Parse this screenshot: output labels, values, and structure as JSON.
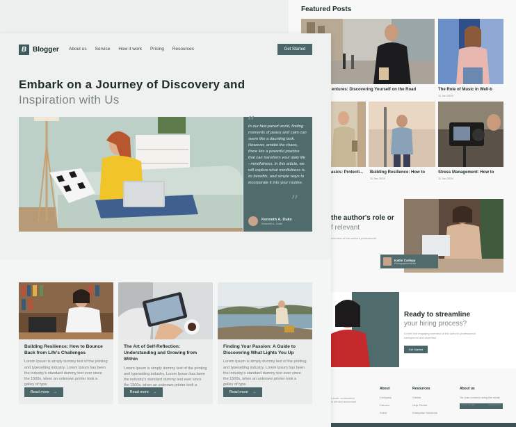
{
  "featured": {
    "title": "Featured Posts",
    "items": [
      {
        "title": "entures: Discovering Yourself on the Road",
        "date": ""
      },
      {
        "title": "The Role of Music in Well-b",
        "date": "11 Jan 2024"
      },
      {
        "title": "asics: Protecti...",
        "date": ""
      },
      {
        "title": "Building Resilience: How to",
        "date": "11 Jan 2024"
      },
      {
        "title": "Stress Management: How to",
        "date": "11 Jan 2024"
      }
    ]
  },
  "author_section": {
    "title": "the author's role or",
    "subtitle": "f relevant",
    "text": "overview of the author's professional",
    "name": "Katlin Carlepy",
    "role": "Photographer/Writer"
  },
  "hire": {
    "title": "Ready to streamline",
    "subtitle": "your hiring process?",
    "text": "A brief and engaging overview of the author's professional background and expertise.",
    "button": "Get Started"
  },
  "footer": {
    "intro": "t amet, consectetur\nis elit sed accumsan",
    "cols": [
      {
        "title": "About",
        "items": [
          "Company",
          "Careers",
          "Event"
        ]
      },
      {
        "title": "Resources",
        "items": [
          "Clients",
          "Help Center",
          "Enterprise Solutions"
        ]
      },
      {
        "title": "About us",
        "items": [
          "You can connect using the email"
        ]
      }
    ],
    "subscribe_placeholder": "Your email",
    "subscribe_button": "Subscribe"
  },
  "brand": {
    "name": "Blogger",
    "logo_letter": "B"
  },
  "nav": [
    "About us",
    "Service",
    "How it work",
    "Pricing",
    "Resources"
  ],
  "header_cta": "Get Started",
  "hero": {
    "title_line1": "Embark on a Journey of Discovery and",
    "title_line2": "Inspiration with Us",
    "quote": "In our fast-paced world, finding moments of peace and calm can seem like a daunting task. However, amidst the chaos, there lies a powerful practice that can transform your daily life - mindfulness. In this article, we will explore what mindfulness is, its benefits, and simple ways to incorporate it into your routine.",
    "author_name": "Kenneth A. Duke",
    "author_role": "Kenneth A. Duke"
  },
  "cards": [
    {
      "title": "Building Resilience: How to Bounce Back from Life's Challenges",
      "body": "Lorem Ipsum is simply dummy text of the printing and typesetting industry. Lorem Ipsum has been the industry's standard dummy text ever since the 1500s, when an unknown printer took a galley of type.",
      "button": "Read more"
    },
    {
      "title": "The Art of Self-Reflection: Understanding and Growing from Within",
      "body": "Lorem Ipsum is simply dummy text of the printing and typesetting industry. Lorem Ipsum has been the industry's standard dummy text ever since the 1500s, when an unknown printer took a galley of type.",
      "button": "Read more"
    },
    {
      "title": "Finding Your Passion: A Guide to Discovering What Lights You Up",
      "body": "Lorem Ipsum is simply dummy text of the printing and typesetting industry. Lorem Ipsum has been the industry's standard dummy text ever since the 1500s, when an unknown printer took a galley of type.",
      "button": "Read more"
    }
  ],
  "colors": {
    "accent": "#4a6668",
    "quote_bg": "#4f6b6c",
    "heading": "#1d2b2b",
    "muted": "#7b8787"
  }
}
